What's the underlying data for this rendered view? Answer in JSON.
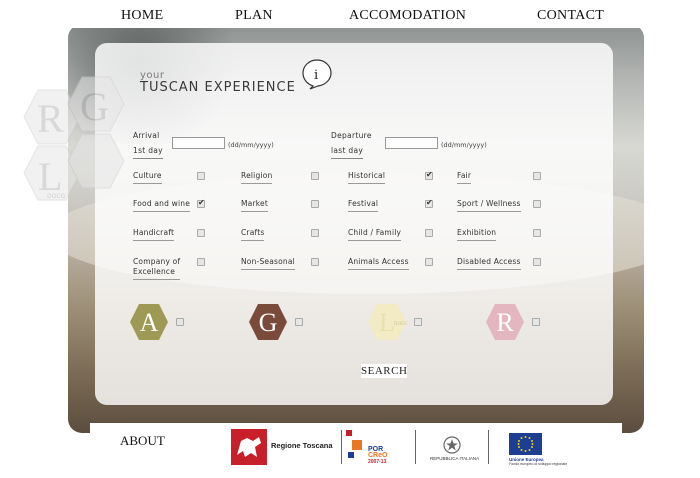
{
  "nav": {
    "home": "HOME",
    "plan": "PLAN",
    "accomodation": "ACCOMODATION",
    "contact": "CONTACT"
  },
  "watermark": {
    "letters": [
      "R",
      "G",
      "L"
    ],
    "sub": "DOCG"
  },
  "title": {
    "your": "your",
    "main": "TUSCAN EXPERIENCE",
    "info": "i"
  },
  "dates": {
    "arrival_label_1": "Arrival",
    "arrival_label_2": "1st day",
    "arrival_value": "",
    "arrival_format": "(dd/mm/yyyy)",
    "departure_label_1": "Departure",
    "departure_label_2": "last day",
    "departure_value": "",
    "departure_format": "(dd/mm/yyyy)"
  },
  "options": [
    {
      "label": "Culture",
      "checked": false
    },
    {
      "label": "Religion",
      "checked": false
    },
    {
      "label": "Historical",
      "checked": true
    },
    {
      "label": "Fair",
      "checked": false
    },
    {
      "label": "Food and wine",
      "checked": true
    },
    {
      "label": "Market",
      "checked": false
    },
    {
      "label": "Festival",
      "checked": true
    },
    {
      "label": "Sport / Wellness",
      "checked": false
    },
    {
      "label": "Handicraft",
      "checked": false
    },
    {
      "label": "Crafts",
      "checked": false
    },
    {
      "label": "Child / Family",
      "checked": false
    },
    {
      "label": "Exhibition",
      "checked": false
    },
    {
      "label": "Company of",
      "label2": "Excellence",
      "checked": false
    },
    {
      "label": "Non-Seasonal",
      "checked": false
    },
    {
      "label": "Animals Access",
      "checked": false
    },
    {
      "label": "Disabled Access",
      "checked": false
    }
  ],
  "badges": [
    {
      "letter": "A",
      "color": "#9e9a56",
      "checked": false
    },
    {
      "letter": "G",
      "color": "#7a4a3a",
      "checked": false
    },
    {
      "letter": "L",
      "sub": "DOCG",
      "color": "#f2ebc4",
      "checked": false
    },
    {
      "letter": "R",
      "color": "#e3b6c0",
      "checked": false
    }
  ],
  "search_label": "SEARCH",
  "footer": {
    "about": "ABOUT",
    "regione": "Regione Toscana",
    "por_line1": "POR",
    "por_line2": "CReO",
    "por_line3": "2007-13",
    "repubblica": "REPUBBLICA ITALIANA",
    "eu_line1": "Unione Europea",
    "eu_line2": "Fondo europeo di sviluppo regionale"
  },
  "colors": {
    "accent_red": "#c8202a",
    "eu_blue": "#1d3f93",
    "eu_yellow": "#f2d200",
    "por_orange": "#e87722"
  }
}
